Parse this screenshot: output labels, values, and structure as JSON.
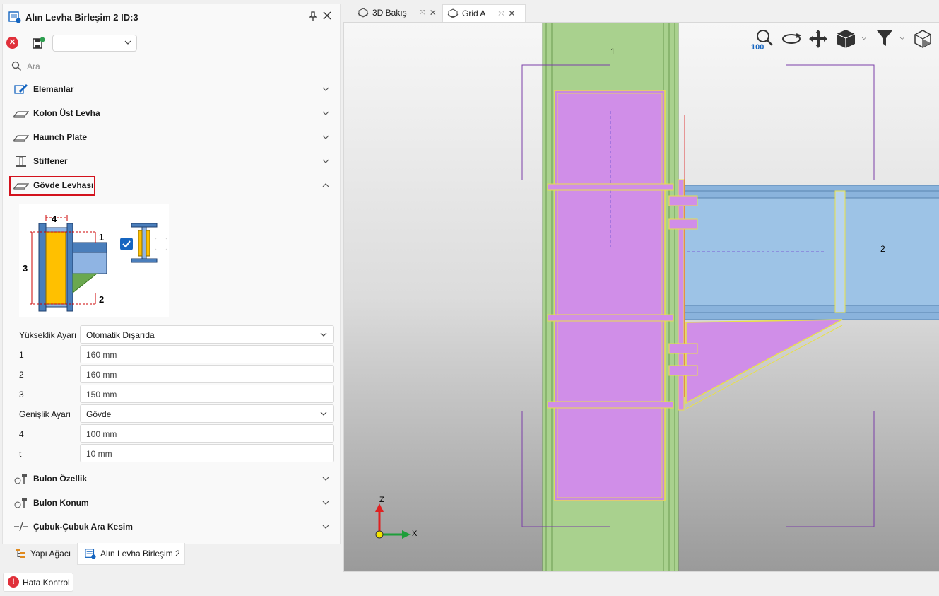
{
  "panel": {
    "title": "Alın Levha Birleşim 2 ID:3",
    "search_placeholder": "Ara",
    "sections": [
      {
        "label": "Elemanlar",
        "icon": "pencil-icon",
        "expanded": false
      },
      {
        "label": "Kolon Üst Levha",
        "icon": "plate-icon",
        "expanded": false
      },
      {
        "label": "Haunch Plate",
        "icon": "plate-icon",
        "expanded": false
      },
      {
        "label": "Stiffener",
        "icon": "stiffener-icon",
        "expanded": false
      },
      {
        "label": "Gövde Levhası",
        "icon": "plate-icon",
        "expanded": true
      }
    ],
    "diagram_labels": {
      "d1": "1",
      "d2": "2",
      "d3": "3",
      "d4": "4"
    },
    "option_checked": true,
    "fields": [
      {
        "label": "Yükseklik Ayarı",
        "value": "Otomatik Dışarıda",
        "type": "select"
      },
      {
        "label": "1",
        "value": "160 mm",
        "type": "input"
      },
      {
        "label": "2",
        "value": "160 mm",
        "type": "input"
      },
      {
        "label": "3",
        "value": "150 mm",
        "type": "input"
      },
      {
        "label": "Genişlik Ayarı",
        "value": "Gövde",
        "type": "select"
      },
      {
        "label": "4",
        "value": "100 mm",
        "type": "input"
      },
      {
        "label": "t",
        "value": "10 mm",
        "type": "input"
      }
    ],
    "bottom_sections": [
      {
        "label": "Bulon Özellik",
        "icon": "bolt-icon"
      },
      {
        "label": "Bulon Konum",
        "icon": "bolt-icon"
      },
      {
        "label": "Çubuk-Çubuk Ara Kesim",
        "icon": "cut-icon"
      }
    ]
  },
  "bottom_tabs": [
    "Yapı Ağacı",
    "Alın Levha Birleşim 2"
  ],
  "status": {
    "hata_label": "Hata Kontrol"
  },
  "view_tabs": [
    {
      "label": "3D Bakış",
      "active": false
    },
    {
      "label": "Grid A",
      "active": true
    }
  ],
  "viewport": {
    "zoom_level": "100",
    "member_labels": {
      "column": "1",
      "beam": "2"
    },
    "axes": {
      "z": "Z",
      "x": "X"
    }
  },
  "colors": {
    "column": "#a9d18e",
    "beam": "#9dc3e6",
    "plate": "#d08ee8",
    "highlight_border": "#d3121d",
    "accent": "#1565c0"
  }
}
